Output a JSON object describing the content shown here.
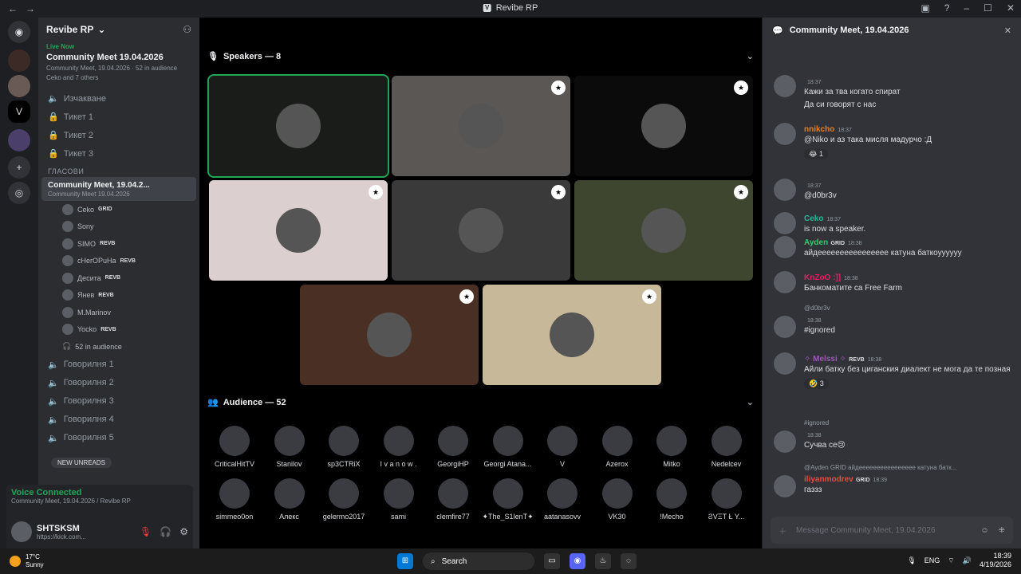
{
  "window": {
    "title": "Revibe RP"
  },
  "server": {
    "name": "Revibe RP"
  },
  "live": {
    "badge": "Live Now",
    "title": "Community Meet 19.04.2026",
    "sub": "Community Meet, 19.04.2026 · 52 in audience",
    "members": "Ceko and 7 others"
  },
  "channels": [
    {
      "label": "Изчакване"
    },
    {
      "label": "Тикет 1"
    },
    {
      "label": "Тикет 2"
    },
    {
      "label": "Тикет 3"
    }
  ],
  "voice_category": "ГЛАСОВИ",
  "active_channel": {
    "label": "Community Meet, 19.04.2...",
    "sub": "Community Meet 19.04.2026"
  },
  "stage_members": [
    {
      "name": "Ceko",
      "tag": "GRID"
    },
    {
      "name": "Sony",
      "tag": ""
    },
    {
      "name": "SIMO",
      "tag": "REVB"
    },
    {
      "name": "cHerOPuHa",
      "tag": "REVB"
    },
    {
      "name": "Десита",
      "tag": "REVB"
    },
    {
      "name": "Янев",
      "tag": "REVB"
    },
    {
      "name": "M.Marinov",
      "tag": ""
    },
    {
      "name": "Yocko",
      "tag": "REVB"
    }
  ],
  "audience_count": "52 in audience",
  "talk_channels": [
    {
      "label": "Говорилня 1"
    },
    {
      "label": "Говорилня 2"
    },
    {
      "label": "Говорилня 3"
    },
    {
      "label": "Говорилня 4"
    },
    {
      "label": "Говорилня 5"
    }
  ],
  "new_unreads": "NEW UNREADS",
  "voice": {
    "status": "Voice Connected",
    "channel": "Community Meet, 19.04.2026 / Revibe RP"
  },
  "user": {
    "name": "SHTSKSM",
    "status": "https://kick.com..."
  },
  "speakers_header": "Speakers — 8",
  "audience_header": "Audience — 52",
  "audience": [
    {
      "name": "CriticalHitTV"
    },
    {
      "name": "Stanilov"
    },
    {
      "name": "sp3CTRiX"
    },
    {
      "name": "I v a n o w ."
    },
    {
      "name": "GeorgiHP"
    },
    {
      "name": "Georgi Atana..."
    },
    {
      "name": "V"
    },
    {
      "name": "Azerox"
    },
    {
      "name": "Mitko"
    },
    {
      "name": "Nedelcev"
    },
    {
      "name": "simmeo0on"
    },
    {
      "name": "Алекс"
    },
    {
      "name": "gelermo2017"
    },
    {
      "name": "sami"
    },
    {
      "name": "clemfire77"
    },
    {
      "name": "✦The_S1lenT✦"
    },
    {
      "name": "aatanasovv"
    },
    {
      "name": "VK30"
    },
    {
      "name": "!Mecho"
    },
    {
      "name": "ƧVΞT Ł Y..."
    }
  ],
  "chat": {
    "title": "Community Meet, 19.04.2026",
    "messages": [
      {
        "name": "",
        "time": "18:37",
        "text": "Кажи за тва когато спират",
        "text2": "Да си говорят с нас"
      },
      {
        "name": "nnikcho",
        "time": "18:37",
        "text": "@Niko и аз така мисля мадурчо :Д",
        "react": "😂 1"
      },
      {
        "name": "",
        "time": "18:37",
        "text": "@d0br3v"
      },
      {
        "name": "Ceko",
        "time": "18:37",
        "text": "is now a speaker."
      },
      {
        "name": "Ayden",
        "tag": "GRID",
        "time": "18:38",
        "text": "айдееееееееееееееее катуна баткоуууууу"
      },
      {
        "name": "KnZoO :]]",
        "time": "18:38",
        "text": "Банкоматите са Free Farm"
      },
      {
        "name": "",
        "time": "18:38",
        "reply": "@d0br3v",
        "text": "#ignored"
      },
      {
        "name": "✧ Melssi ✧",
        "tag": "REVB",
        "time": "18:38",
        "text": "Айли батку без циганския диалект не мога да те позная",
        "react": "🤣 3"
      },
      {
        "name": "",
        "time": "18:38",
        "reply": "#ignored",
        "text": "Сучва се😢"
      },
      {
        "name": "iliyanmodrev",
        "tag": "GRID",
        "time": "18:39",
        "reply": "@Ayden GRID айдееееееееееееееее катуна батк...",
        "text": "газзз"
      }
    ],
    "placeholder": "Message Community Meet, 19.04.2026"
  },
  "taskbar": {
    "temp": "17°C",
    "weather": "Sunny",
    "search": "Search",
    "lang": "ENG",
    "time": "18:39",
    "date": "4/19/2026"
  },
  "colors": {
    "accent": "#5865f2",
    "green": "#23a559",
    "bg": "#1e1f22"
  }
}
